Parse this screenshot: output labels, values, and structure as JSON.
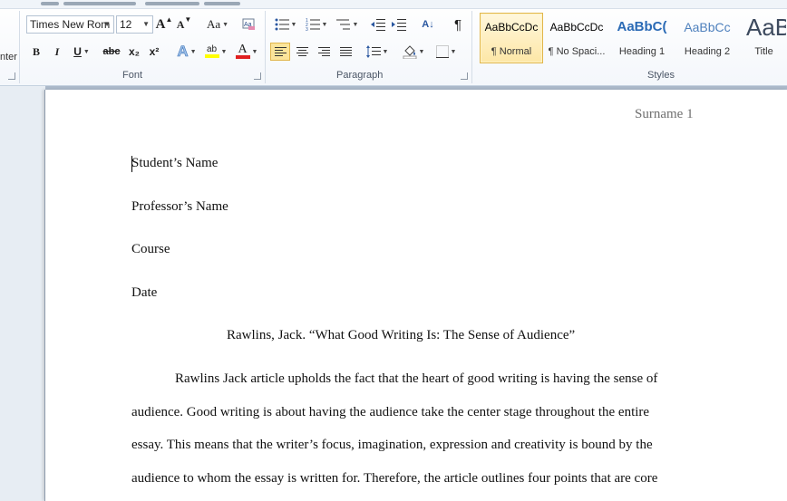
{
  "ribbon": {
    "clipboard": {
      "format_painter_partial": "nter"
    },
    "font": {
      "group_label": "Font",
      "font_name": "Times New Rom",
      "font_size": "12",
      "grow_label": "A",
      "shrink_label": "A",
      "change_case_label": "Aa",
      "bold": "B",
      "italic": "I",
      "underline": "U",
      "strikethrough": "abc",
      "subscript": "x₂",
      "superscript": "x²",
      "text_effects": "A",
      "highlight": "ab",
      "font_color": "A",
      "highlight_color": "#ffff00",
      "font_color_value": "#e02020"
    },
    "paragraph": {
      "group_label": "Paragraph",
      "sort_label": "A↓",
      "show_marks": "¶"
    },
    "styles": {
      "group_label": "Styles",
      "tiles": [
        {
          "sample": "AaBbCcDc",
          "name": "¶ Normal"
        },
        {
          "sample": "AaBbCcDc",
          "name": "¶ No Spaci..."
        },
        {
          "sample": "AaBbC(",
          "name": "Heading 1"
        },
        {
          "sample": "AaBbCc",
          "name": "Heading 2"
        },
        {
          "sample": "AaB",
          "name": "Title"
        }
      ],
      "accent": "#e1b64b"
    }
  },
  "document": {
    "header": "Surname 1",
    "lines": [
      "Student’s Name",
      "Professor’s Name",
      "Course",
      "Date"
    ],
    "title": "Rawlins, Jack. “What Good Writing Is: The Sense of Audience”",
    "body": [
      "Rawlins Jack article upholds the fact that the heart of good writing is having the sense of",
      "audience. Good writing is about having the audience take the center stage throughout the entire",
      "essay. This means that the writer’s focus, imagination,  expression and creativity is bound by the",
      "audience to whom the essay is written for. Therefore, the article outlines four points that are core"
    ]
  }
}
